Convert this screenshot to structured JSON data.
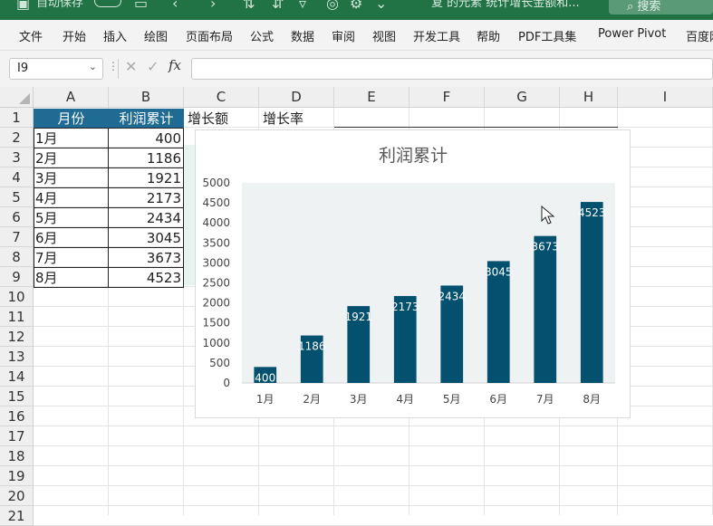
{
  "titlebar": {
    "autosave": "自动保存",
    "doc_title": "复 的元素 统计增长金额和...",
    "search": "搜索"
  },
  "menu": [
    "文件",
    "开始",
    "插入",
    "绘图",
    "页面布局",
    "公式",
    "数据",
    "审阅",
    "视图",
    "开发工具",
    "帮助",
    "PDF工具集",
    "Power Pivot",
    "百度网"
  ],
  "formula_bar": {
    "name_box": "I9",
    "fx": "fx",
    "formula": ""
  },
  "columns": [
    "A",
    "B",
    "C",
    "D",
    "E",
    "F",
    "G",
    "H",
    "I"
  ],
  "rows": [
    "1",
    "2",
    "3",
    "4",
    "5",
    "6",
    "7",
    "8",
    "9",
    "10",
    "11",
    "12",
    "13",
    "14",
    "15",
    "16",
    "17",
    "18",
    "19",
    "20",
    "21"
  ],
  "sheet": {
    "headers": {
      "A1": "月份",
      "B1": "利润累计",
      "C1": "增长额",
      "D1": "增长率"
    },
    "data": [
      {
        "month": "1月",
        "value": "400"
      },
      {
        "month": "2月",
        "value": "1186"
      },
      {
        "month": "3月",
        "value": "1921"
      },
      {
        "month": "4月",
        "value": "2173"
      },
      {
        "month": "5月",
        "value": "2434"
      },
      {
        "month": "6月",
        "value": "3045"
      },
      {
        "month": "7月",
        "value": "3673"
      },
      {
        "month": "8月",
        "value": "4523"
      }
    ]
  },
  "chart_data": {
    "type": "bar",
    "title": "利润累计",
    "categories": [
      "1月",
      "2月",
      "3月",
      "4月",
      "5月",
      "6月",
      "7月",
      "8月"
    ],
    "values": [
      400,
      1186,
      1921,
      2173,
      2434,
      3045,
      3673,
      4523
    ],
    "ylim": [
      0,
      5000
    ],
    "yticks": [
      0,
      500,
      1000,
      1500,
      2000,
      2500,
      3000,
      3500,
      4000,
      4500,
      5000
    ],
    "data_labels": true,
    "grid": false,
    "colors": {
      "bar": "#03506f",
      "plot_bg": "#eff2f3",
      "label": "#ffffff"
    }
  },
  "colors": {
    "excel_green": "#217346",
    "header_fill": "#1f6b94"
  }
}
